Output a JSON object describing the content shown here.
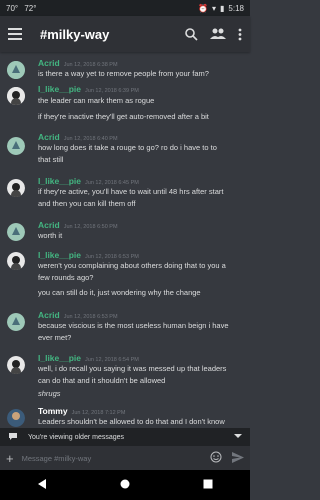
{
  "status": {
    "time_left": "70°",
    "temp": "72°",
    "clock": "5:18"
  },
  "header": {
    "channel": "#milky-way"
  },
  "messages": [
    {
      "author": "Acrid",
      "timestamp": "Jun 12, 2018 6:38 PM",
      "color": "#43b581",
      "lines": [
        "is there a way yet to remove people from your fam?"
      ]
    },
    {
      "author": "I_like__pie",
      "timestamp": "Jun 12, 2018 6:39 PM",
      "color": "#43b581",
      "lines": [
        "the leader can mark them as rogue",
        "if they're inactive they'll get auto-removed after a bit"
      ]
    },
    {
      "author": "Acrid",
      "timestamp": "Jun 12, 2018 6:40 PM",
      "color": "#43b581",
      "lines": [
        "how long does it take a rouge to go?  ro do i have to to",
        "that still"
      ]
    },
    {
      "author": "I_like__pie",
      "timestamp": "Jun 12, 2018 6:45 PM",
      "color": "#43b581",
      "lines": [
        "if they're active, you'll have to wait until 48 hrs after start",
        "and then you can kill them off"
      ]
    },
    {
      "author": "Acrid",
      "timestamp": "Jun 12, 2018 6:50 PM",
      "color": "#43b581",
      "lines": [
        "worth it"
      ]
    },
    {
      "author": "I_like__pie",
      "timestamp": "Jun 12, 2018 6:53 PM",
      "color": "#43b581",
      "lines": [
        "weren't you complaining about others doing that to you a",
        "few rounds ago?",
        "you can still do it, just wondering why the change"
      ]
    },
    {
      "author": "Acrid",
      "timestamp": "Jun 12, 2018 6:53 PM",
      "color": "#43b581",
      "lines": [
        "because viscious is the most useless human beign i have",
        "ever met?"
      ]
    },
    {
      "author": "I_like__pie",
      "timestamp": "Jun 12, 2018 6:54 PM",
      "color": "#43b581",
      "lines": [
        "well, i do recall you saying it was messed up that leaders",
        "can do that and it shouldn't be allowed",
        "shrugs"
      ]
    },
    {
      "author": "Tommy",
      "timestamp": "Jun 12, 2018 7:12 PM",
      "color": "#ffffff",
      "lines": [
        "Leaders shouldn't be allowed to do that and I don't know"
      ]
    }
  ],
  "banner": {
    "text": "You're viewing older messages"
  },
  "composer": {
    "placeholder": "Message #milky-way"
  }
}
